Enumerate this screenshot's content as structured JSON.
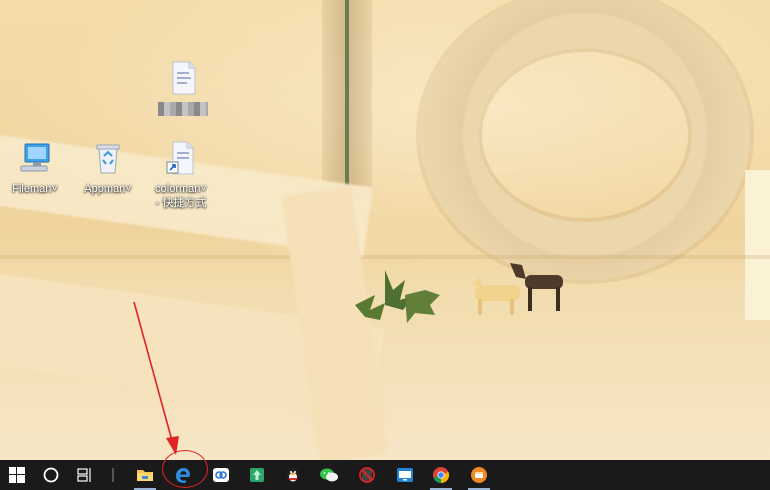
{
  "desktop": {
    "icons": [
      {
        "name": "unnamed-file",
        "label": "",
        "label2": "",
        "blurred": true
      },
      {
        "name": "fileman",
        "label": "Fileman˅",
        "label2": ""
      },
      {
        "name": "appman",
        "label": "Appman˅",
        "label2": ""
      },
      {
        "name": "colorman",
        "label": "colorman˅",
        "label2": "- 快捷方式"
      }
    ]
  },
  "taskbar": {
    "items": [
      {
        "name": "start-button",
        "icon": "windows-logo-icon"
      },
      {
        "name": "cortana-button",
        "icon": "circle-search-icon"
      },
      {
        "name": "task-view-button",
        "icon": "task-view-icon"
      },
      {
        "name": "file-explorer-button",
        "icon": "folder-icon"
      },
      {
        "name": "edge-button",
        "icon": "edge-browser-icon"
      },
      {
        "name": "baidu-netdisk-button",
        "icon": "cloud-icon"
      },
      {
        "name": "app-green-button",
        "icon": "green-app-icon"
      },
      {
        "name": "qq-button",
        "icon": "penguin-icon"
      },
      {
        "name": "wechat-button",
        "icon": "wechat-icon"
      },
      {
        "name": "blocked-app-button",
        "icon": "no-entry-icon"
      },
      {
        "name": "remote-desktop-button",
        "icon": "monitor-icon"
      },
      {
        "name": "chrome-button",
        "icon": "chrome-icon"
      },
      {
        "name": "orange-app-button",
        "icon": "orange-app-icon"
      }
    ]
  },
  "colors": {
    "taskbar_bg": "#1a1a1a",
    "annotation_red": "#e02424",
    "active_indicator": "#9ab4d8"
  }
}
